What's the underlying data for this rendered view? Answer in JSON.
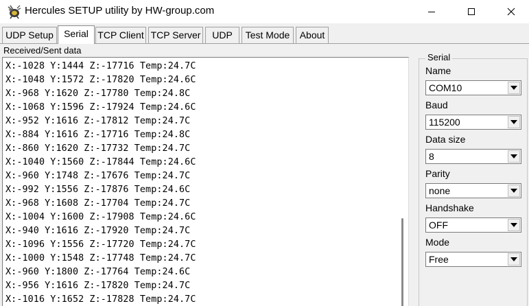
{
  "window": {
    "title": "Hercules SETUP utility by HW-group.com",
    "icon": "hercules-app-icon"
  },
  "tabs": [
    {
      "label": "UDP Setup"
    },
    {
      "label": "Serial",
      "active": true
    },
    {
      "label": "TCP Client"
    },
    {
      "label": "TCP Server"
    },
    {
      "label": "UDP"
    },
    {
      "label": "Test Mode"
    },
    {
      "label": "About"
    }
  ],
  "received": {
    "label": "Received/Sent data",
    "lines": [
      "X:-1028 Y:1444 Z:-17716 Temp:24.7C",
      "X:-1048 Y:1572 Z:-17820 Temp:24.6C",
      "X:-968 Y:1620 Z:-17780 Temp:24.8C",
      "X:-1068 Y:1596 Z:-17924 Temp:24.6C",
      "X:-952 Y:1616 Z:-17812 Temp:24.7C",
      "X:-884 Y:1616 Z:-17716 Temp:24.8C",
      "X:-860 Y:1620 Z:-17732 Temp:24.7C",
      "X:-1040 Y:1560 Z:-17844 Temp:24.6C",
      "X:-960 Y:1748 Z:-17676 Temp:24.7C",
      "X:-992 Y:1556 Z:-17876 Temp:24.6C",
      "X:-968 Y:1608 Z:-17704 Temp:24.7C",
      "X:-1004 Y:1600 Z:-17908 Temp:24.6C",
      "X:-940 Y:1616 Z:-17920 Temp:24.7C",
      "X:-1096 Y:1556 Z:-17720 Temp:24.7C",
      "X:-1000 Y:1548 Z:-17748 Temp:24.7C",
      "X:-960 Y:1800 Z:-17764 Temp:24.6C",
      "X:-956 Y:1616 Z:-17820 Temp:24.7C",
      "X:-1016 Y:1652 Z:-17828 Temp:24.7C"
    ]
  },
  "serial": {
    "group_label": "Serial",
    "name_label": "Name",
    "name_value": "COM10",
    "baud_label": "Baud",
    "baud_value": "115200",
    "datasize_label": "Data size",
    "datasize_value": "8",
    "parity_label": "Parity",
    "parity_value": "none",
    "handshake_label": "Handshake",
    "handshake_value": "OFF",
    "mode_label": "Mode",
    "mode_value": "Free"
  }
}
